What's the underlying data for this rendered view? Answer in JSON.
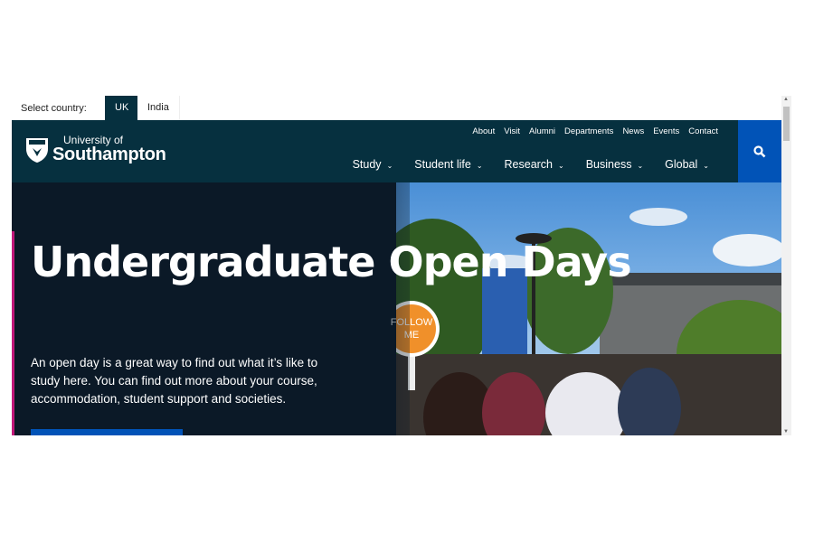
{
  "country_selector": {
    "label": "Select country:",
    "options": [
      "UK",
      "India"
    ],
    "selected": "UK"
  },
  "header": {
    "logo": {
      "line1": "University of",
      "line2": "Southampton"
    },
    "utility_links": [
      "About",
      "Visit",
      "Alumni",
      "Departments",
      "News",
      "Events",
      "Contact"
    ],
    "main_nav": [
      "Study",
      "Student life",
      "Research",
      "Business",
      "Global"
    ],
    "search_icon": "search-icon"
  },
  "hero": {
    "title": "Undergraduate Open Days",
    "description": "An open day is a great way to find out what it’s like to study here. You can find out more about your course, accommodation, student support and societies.",
    "sign_text": "FOLLOW ME",
    "accent_color": "#c2187a",
    "button_color": "#0153b7"
  },
  "colors": {
    "header_bg": "#06303f",
    "hero_bg": "#0b1927"
  }
}
